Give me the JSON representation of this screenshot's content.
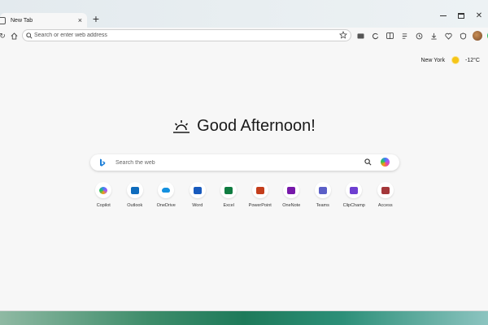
{
  "browser": {
    "tab": {
      "title": "New Tab",
      "close": "×"
    },
    "new_tab": "+",
    "window": {
      "close": "✕"
    }
  },
  "toolbar": {
    "back": "‹",
    "refresh": "↻",
    "home": "⌂",
    "address_placeholder": "Search or enter web address"
  },
  "weather": {
    "city": "New York",
    "temperature": "-12°C",
    "icon": "sun-icon"
  },
  "greeting": {
    "text": "Good Afternoon!",
    "icon": "sunrise-icon"
  },
  "search": {
    "placeholder": "Search the web",
    "logo": "bing-logo"
  },
  "apps": [
    {
      "label": "Copilot",
      "color": "#8b5cf6"
    },
    {
      "label": "Outlook",
      "color": "#0f6cbd"
    },
    {
      "label": "OneDrive",
      "color": "#1490df"
    },
    {
      "label": "Word",
      "color": "#185abd"
    },
    {
      "label": "Excel",
      "color": "#107c41"
    },
    {
      "label": "PowerPoint",
      "color": "#c43e1c"
    },
    {
      "label": "OneNote",
      "color": "#7719aa"
    },
    {
      "label": "Teams",
      "color": "#5b5fc7"
    },
    {
      "label": "ClipChamp",
      "color": "#6e3fd1"
    },
    {
      "label": "Access",
      "color": "#a4373a"
    }
  ],
  "colors": {
    "accent": "#0f6cbd",
    "page_bg": "#f7f7f7",
    "desktop_teal": "#1e7a5a"
  }
}
